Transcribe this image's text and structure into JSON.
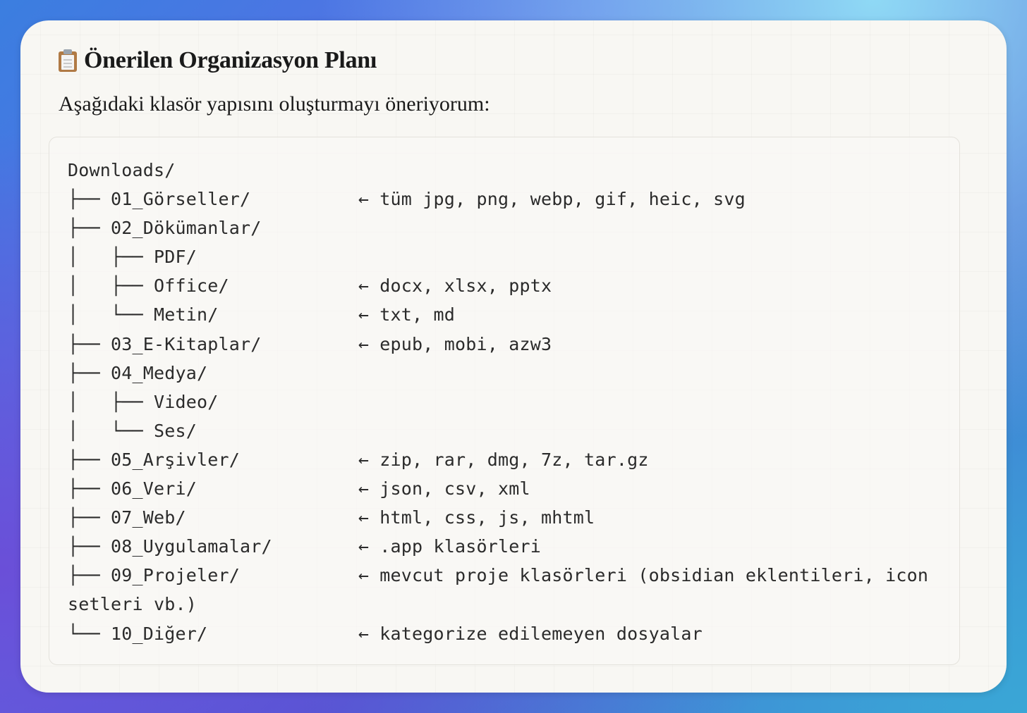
{
  "heading": {
    "icon": "clipboard-icon",
    "text": "Önerilen Organizasyon Planı"
  },
  "subtitle": "Aşağıdaki klasör yapısını oluşturmayı öneriyorum:",
  "tree_lines": [
    "Downloads/",
    "├── 01_Görseller/          ← tüm jpg, png, webp, gif, heic, svg",
    "├── 02_Dökümanlar/",
    "│   ├── PDF/",
    "│   ├── Office/            ← docx, xlsx, pptx",
    "│   └── Metin/             ← txt, md",
    "├── 03_E-Kitaplar/         ← epub, mobi, azw3",
    "├── 04_Medya/",
    "│   ├── Video/",
    "│   └── Ses/",
    "├── 05_Arşivler/           ← zip, rar, dmg, 7z, tar.gz",
    "├── 06_Veri/               ← json, csv, xml",
    "├── 07_Web/                ← html, css, js, mhtml",
    "├── 08_Uygulamalar/        ← .app klasörleri",
    "├── 09_Projeler/           ← mevcut proje klasörleri (obsidian eklentileri, icon",
    "setleri vb.)",
    "└── 10_Diğer/              ← kategorize edilemeyen dosyalar"
  ]
}
